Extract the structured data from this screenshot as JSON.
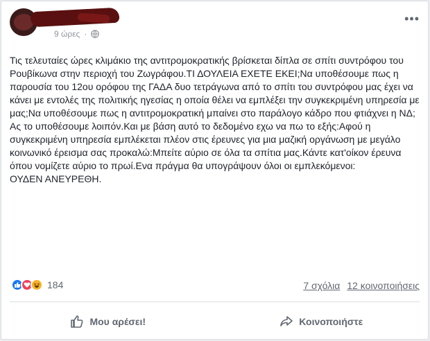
{
  "post": {
    "time": "9 ώρες",
    "privacy_icon": "globe-icon",
    "paragraphs": [
      "Τις τελευταίες ώρες κλιμάκιο της αντιτρομοκρατικής βρίσκεται δίπλα σε σπίτι συντρόφου του Ρουβίκωνα στην περιοχή του Ζωγράφου.ΤΙ ΔΟΥΛΕΙΑ ΕΧΕΤΕ ΕΚΕΙ;Να υποθέσουμε πως η παρουσία του 12ου ορόφου της ΓΑΔΑ δυο τετράγωνα από το σπίτι του συντρόφου μας έχει να κάνει με εντολές της πολιτικής ηγεσίας η οποία θέλει να εμπλέξει την συγκεκριμένη υπηρεσία με μας;Να υποθέσουμε πως η αντιτρομοκρατική μπαίνει στο παράλογο κάδρο που φτιάχνει η ΝΔ;",
      "Ας το υποθέσουμε λοιπόν.Και με βάση αυτό το δεδομένο εχω να πω το εξής:Αφού η συγκεκριμένη υπηρεσία εμπλέκεται πλέον στις έρευνες για μια μαζική οργάνωση με μεγάλο κοινωνικό έρεισμα σας προκαλώ:Μπείτε αύριο σε όλα τα σπίτια μας.Κάντε κατ'οίκον έρευνα όπου νομίζετε αύριο το πρωί.Ενα πράγμα θα υπογράψουν όλοι οι εμπλεκόμενοι:",
      "ΟΥΔΕΝ ΑΝΕΥΡΕΘΗ."
    ]
  },
  "reactions": {
    "icons": [
      "like-icon",
      "love-icon",
      "haha-icon"
    ],
    "count": "184"
  },
  "stats": {
    "comments": "7 σχόλια",
    "shares": "12 κοινοποιήσεις"
  },
  "actions": {
    "like_label": "Μου αρέσει!",
    "share_label": "Κοινοποιήστε"
  },
  "colors": {
    "like": "#1877f2",
    "love": "#f33e58",
    "haha": "#f7b125",
    "muted": "#606770"
  }
}
